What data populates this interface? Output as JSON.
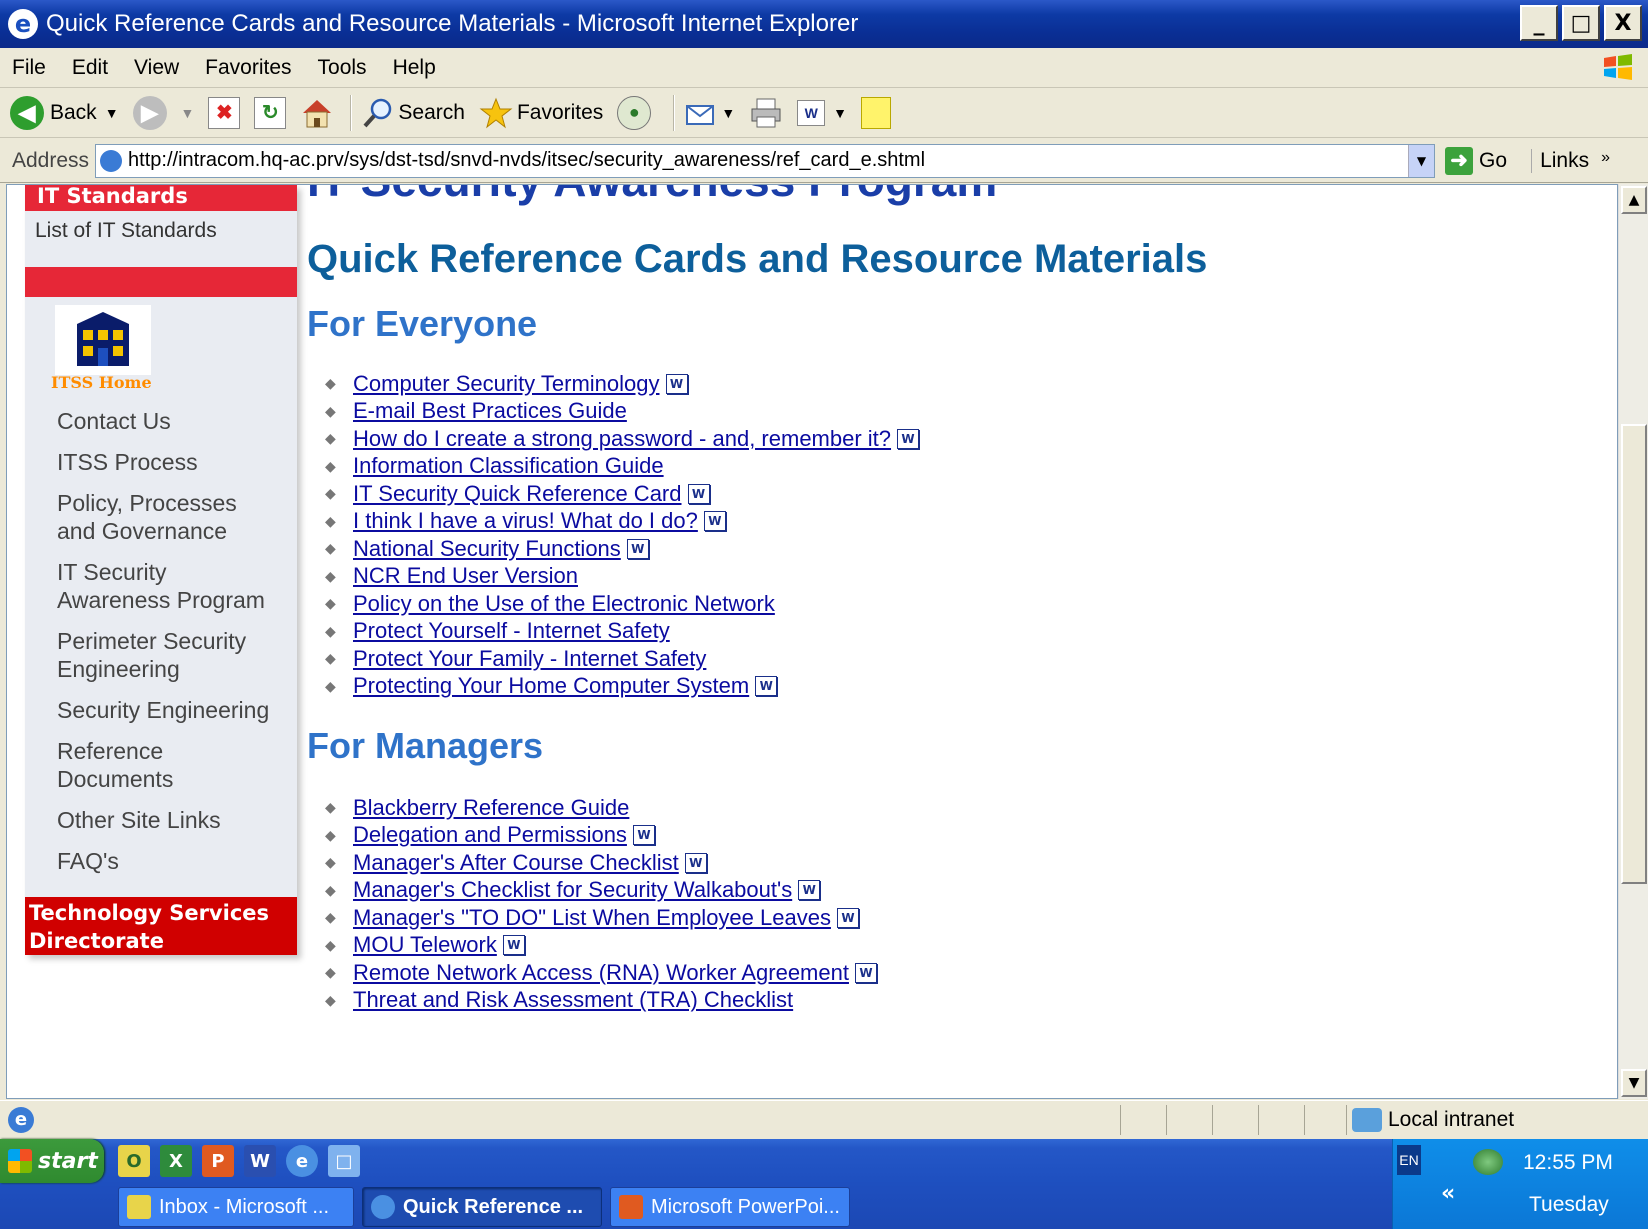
{
  "window": {
    "title": "Quick Reference Cards and Resource Materials - Microsoft Internet Explorer",
    "controls": [
      "_",
      "□",
      "X"
    ]
  },
  "menu": [
    "File",
    "Edit",
    "View",
    "Favorites",
    "Tools",
    "Help"
  ],
  "toolbar": {
    "back": "Back",
    "search": "Search",
    "favorites": "Favorites"
  },
  "address": {
    "label": "Address",
    "url": "http://intracom.hq-ac.prv/sys/dst-tsd/snvd-nvds/itsec/security_awareness/ref_card_e.shtml",
    "go": "Go",
    "links": "Links",
    "links_chevron": "»"
  },
  "leftnav": {
    "header": "IT Standards",
    "list_link": "List of IT Standards",
    "home_label": "ITSS Home",
    "items": [
      "Contact Us",
      "ITSS Process",
      "Policy, Processes and Governance",
      "IT Security Awareness Program",
      "Perimeter Security Engineering",
      "Security Engineering",
      "Reference Documents",
      "Other Site Links",
      "FAQ's"
    ],
    "footer": "Technology Services Directorate"
  },
  "content": {
    "program_title": "IT Security Awareness Program",
    "page_title": "Quick Reference Cards and Resource Materials",
    "sections": [
      {
        "title": "For Everyone",
        "links": [
          {
            "text": "Computer Security Terminology",
            "word": true
          },
          {
            "text": "E-mail Best Practices Guide",
            "word": false
          },
          {
            "text": "How do I create a strong password - and, remember it?",
            "word": true
          },
          {
            "text": "Information Classification Guide",
            "word": false
          },
          {
            "text": "IT Security Quick Reference Card",
            "word": true
          },
          {
            "text": "I think I have a virus! What do I do?",
            "word": true
          },
          {
            "text": "National Security Functions",
            "word": true
          },
          {
            "text": "NCR End User Version",
            "word": false
          },
          {
            "text": "Policy on the Use of the Electronic Network",
            "word": false
          },
          {
            "text": "Protect Yourself - Internet Safety",
            "word": false
          },
          {
            "text": "Protect Your Family - Internet Safety",
            "word": false
          },
          {
            "text": "Protecting Your Home Computer System",
            "word": true
          }
        ]
      },
      {
        "title": "For Managers",
        "links": [
          {
            "text": "Blackberry Reference Guide",
            "word": false
          },
          {
            "text": " Delegation and Permissions",
            "word": true
          },
          {
            "text": "Manager's After Course Checklist",
            "word": true
          },
          {
            "text": "Manager's Checklist for Security Walkabout's",
            "word": true
          },
          {
            "text": "Manager's \"TO DO\" List When Employee Leaves",
            "word": true
          },
          {
            "text": "MOU Telework",
            "word": true
          },
          {
            "text": "Remote Network Access (RNA) Worker Agreement",
            "word": true
          },
          {
            "text": "Threat and Risk Assessment (TRA) Checklist",
            "word": false
          }
        ]
      }
    ]
  },
  "status": {
    "zone": "Local intranet"
  },
  "taskbar": {
    "start": "start",
    "tasks": [
      "Inbox - Microsoft ...",
      "Quick Reference ...",
      "Microsoft PowerPoi..."
    ],
    "language": "EN",
    "chevron": "«",
    "time": "12:55 PM",
    "day": "Tuesday"
  }
}
